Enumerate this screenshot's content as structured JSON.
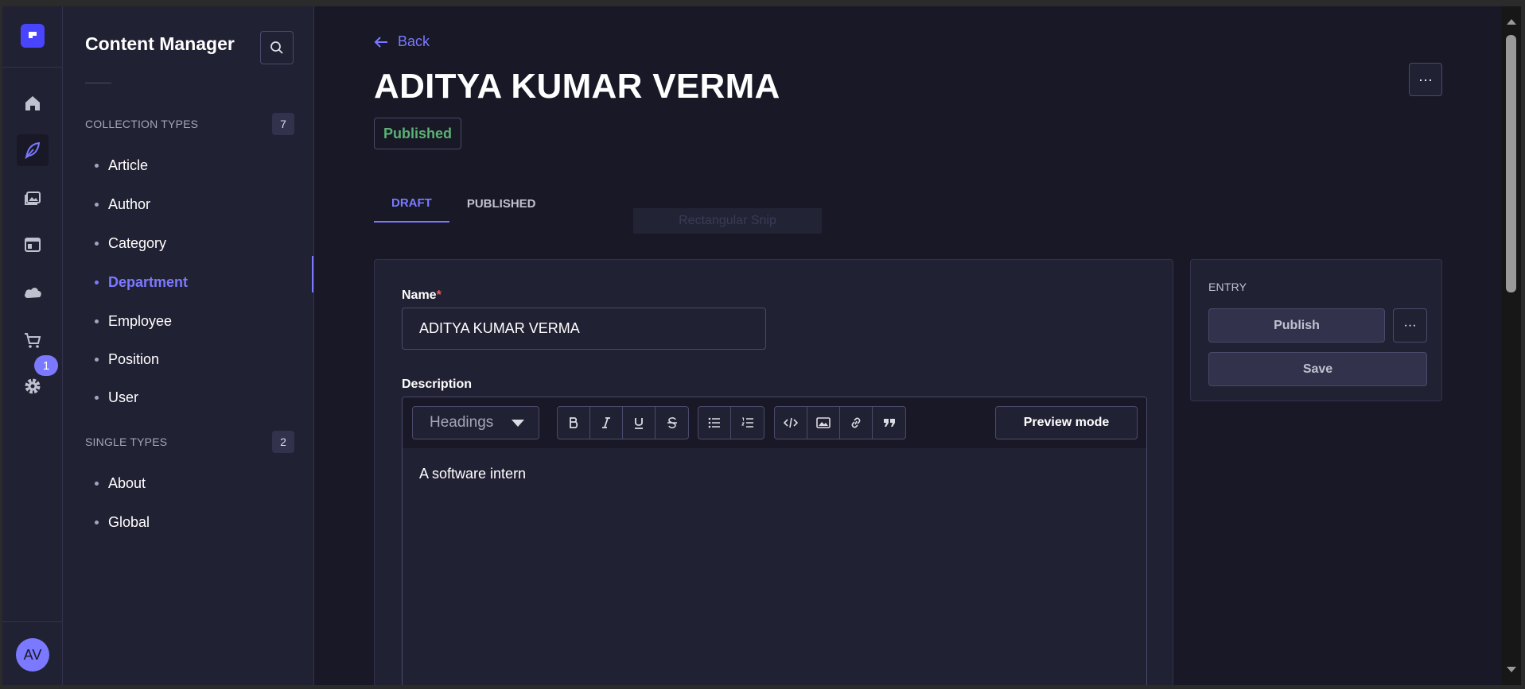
{
  "rail": {
    "settings_badge": "1",
    "avatar_initials": "AV",
    "icons": [
      "home-icon",
      "content-manager-icon",
      "media-library-icon",
      "content-type-builder-icon",
      "cloud-icon",
      "marketplace-icon",
      "settings-icon"
    ]
  },
  "subnav": {
    "title": "Content Manager",
    "collection_types": {
      "label": "COLLECTION TYPES",
      "count": "7",
      "items": [
        {
          "label": "Article"
        },
        {
          "label": "Author"
        },
        {
          "label": "Category"
        },
        {
          "label": "Department"
        },
        {
          "label": "Employee"
        },
        {
          "label": "Position"
        },
        {
          "label": "User"
        }
      ]
    },
    "single_types": {
      "label": "SINGLE TYPES",
      "count": "2",
      "items": [
        {
          "label": "About"
        },
        {
          "label": "Global"
        }
      ]
    }
  },
  "header": {
    "back_label": "Back",
    "title": "ADITYA KUMAR VERMA",
    "status": "Published",
    "more_label": "···"
  },
  "tabs": [
    {
      "label": "DRAFT"
    },
    {
      "label": "PUBLISHED"
    }
  ],
  "overlay": {
    "snip_label": "Rectangular Snip"
  },
  "form": {
    "name_label": "Name",
    "name_required": "*",
    "name_value": "ADITYA KUMAR VERMA",
    "description_label": "Description",
    "editor": {
      "headings_label": "Headings",
      "preview_label": "Preview mode",
      "content": "A software intern"
    }
  },
  "entry": {
    "title": "ENTRY",
    "publish_label": "Publish",
    "more_label": "···",
    "save_label": "Save"
  },
  "colors": {
    "background": "#181826",
    "panel": "#212134",
    "accent": "#7b79ff",
    "success": "#5cb176",
    "required": "#ee5e52"
  }
}
